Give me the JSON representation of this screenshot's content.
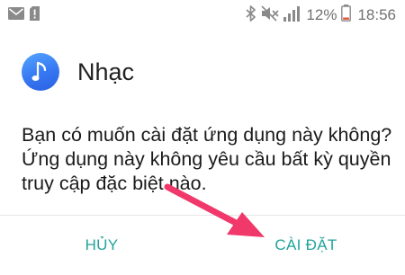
{
  "status_bar": {
    "left_icons": [
      "mail-icon",
      "alert-icon"
    ],
    "right_icons": [
      "bluetooth-icon",
      "mute-icon",
      "signal-icon",
      "battery-icon"
    ],
    "battery_percent": "12%",
    "time": "18:56"
  },
  "dialog": {
    "app_name": "Nhạc",
    "app_icon": "music-note-icon",
    "message": "Bạn có muốn cài đặt ứng dụng này không? Ứng dụng này không yêu cầu bất kỳ quyền truy cập đặc biệt nào.",
    "cancel_label": "HỦY",
    "install_label": "CÀI ĐẶT"
  },
  "colors": {
    "accent": "#21a39a",
    "annotation_arrow": "#f0386a",
    "app_icon": "#3677f2"
  }
}
